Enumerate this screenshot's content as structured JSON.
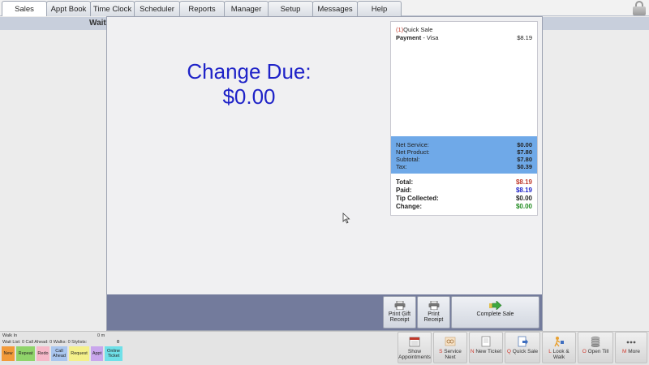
{
  "tabs": [
    {
      "label": "Sales",
      "active": true
    },
    {
      "label": "Appt Book",
      "active": false
    },
    {
      "label": "Time Clock",
      "active": false
    },
    {
      "label": "Scheduler",
      "active": false
    },
    {
      "label": "Reports",
      "active": false
    },
    {
      "label": "Manager",
      "active": false
    },
    {
      "label": "Setup",
      "active": false
    },
    {
      "label": "Messages",
      "active": false
    },
    {
      "label": "Help",
      "active": false
    }
  ],
  "background": {
    "wait_label": "Wait"
  },
  "modal": {
    "change_due_label": "Change Due:",
    "change_due_value": "$0.00",
    "receipt": {
      "item_qty": "(1)",
      "item_name": "Quick Sale",
      "payment_label": "Payment",
      "payment_method": " - Visa",
      "payment_amount": "$8.19"
    },
    "totals": {
      "net_service_label": "Net Service:",
      "net_service_value": "$0.00",
      "net_product_label": "Net Product:",
      "net_product_value": "$7.80",
      "subtotal_label": "Subtotal:",
      "subtotal_value": "$7.80",
      "tax_label": "Tax:",
      "tax_value": "$0.39"
    },
    "summary": {
      "total_label": "Total:",
      "total_value": "$8.19",
      "paid_label": "Paid:",
      "paid_value": "$8.19",
      "tip_label": "Tip Collected:",
      "tip_value": "$0.00",
      "change_label": "Change:",
      "change_value": "$0.00"
    },
    "footer": {
      "print_gift_receipt": "Print Gift Receipt",
      "print_receipt": "Print Receipt",
      "complete_sale": "Complete Sale"
    }
  },
  "walkin": {
    "title": "Walk In",
    "time": "0 m",
    "stats": "Wait List: 0   Call Ahead: 0   Walks: 0   Stylists:",
    "count": "0",
    "chips": [
      {
        "label": "New",
        "color": "#f29a3a"
      },
      {
        "label": "Repeat",
        "color": "#8fd46a"
      },
      {
        "label": "Redo",
        "color": "#f6b8c8"
      },
      {
        "label": "Call Ahead",
        "color": "#a9c6ee"
      },
      {
        "label": "Request",
        "color": "#f4f08a"
      },
      {
        "label": "Appt",
        "color": "#c9a6ec"
      },
      {
        "label": "Online Ticket",
        "color": "#6fe0e8"
      }
    ]
  },
  "actions": [
    {
      "key": "",
      "label": "Show Appointments",
      "icon": "calendar-icon"
    },
    {
      "key": "S",
      "label": "Service Next",
      "icon": "scissors-icon"
    },
    {
      "key": "N",
      "label": "New Ticket",
      "icon": "ticket-icon"
    },
    {
      "key": "Q",
      "label": "Quick Sale",
      "icon": "quick-sale-icon"
    },
    {
      "key": "L",
      "label": "Look & Walk",
      "icon": "look-walk-icon"
    },
    {
      "key": "O",
      "label": "Open Till",
      "icon": "till-icon"
    },
    {
      "key": "M",
      "label": "More",
      "icon": "more-icon"
    }
  ],
  "colors": {
    "change_due": "#1f23c8",
    "total": "#c0392b",
    "paid": "#1f23c8",
    "change": "#1e8a1e",
    "totals_panel": "#6fa9e8",
    "modal_footer": "#737b9c"
  }
}
